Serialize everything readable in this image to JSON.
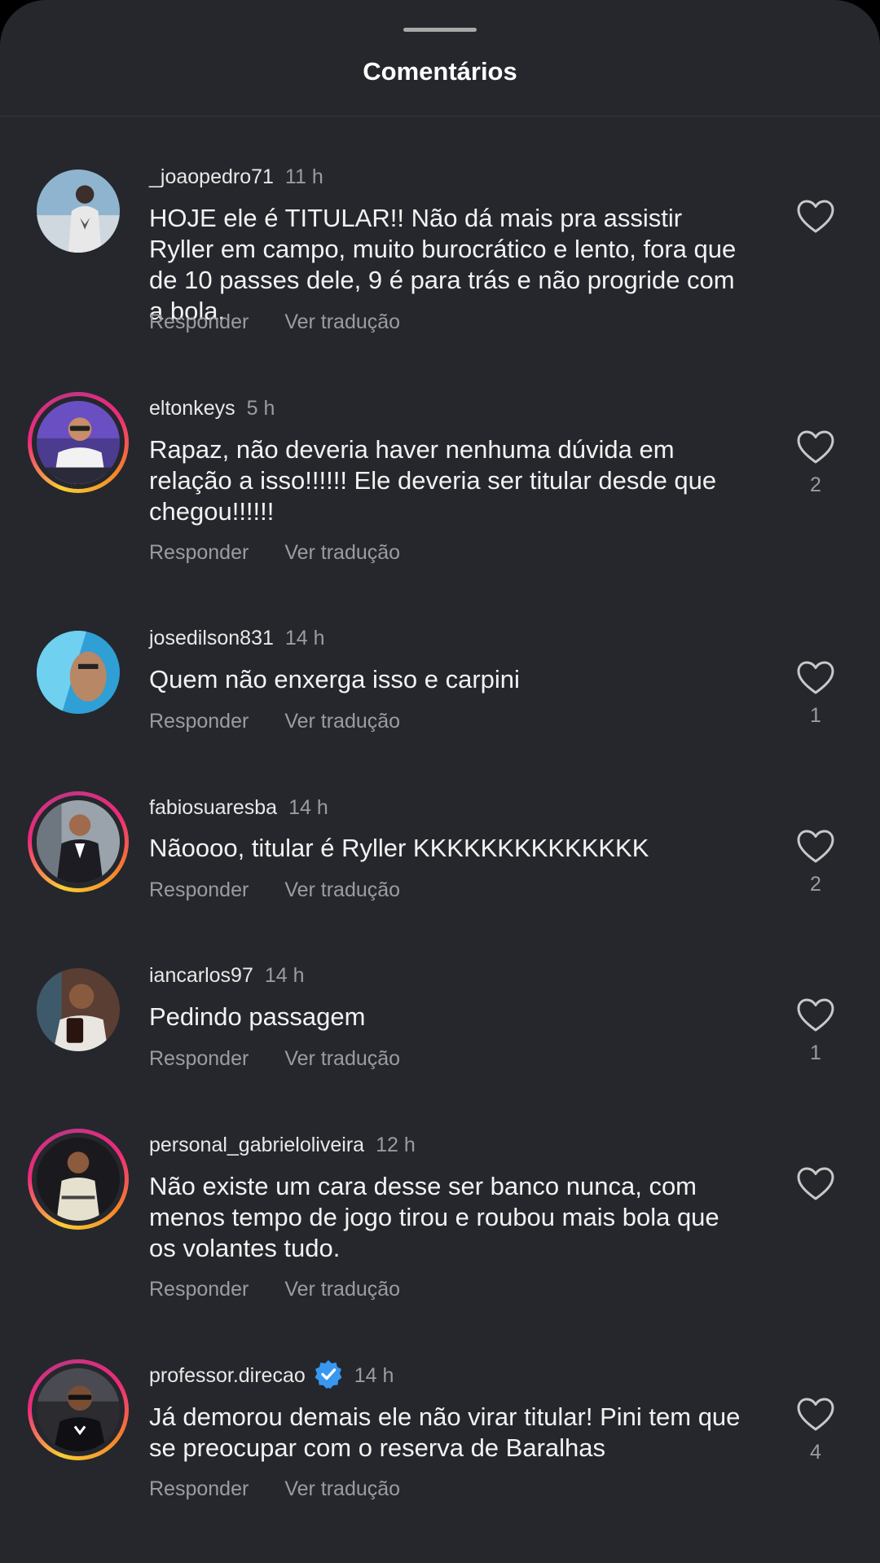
{
  "header": {
    "title": "Comentários"
  },
  "comments": [
    {
      "username": "_joaopedro71",
      "time": "11 h",
      "text": "HOJE ele é TITULAR!! Não dá mais pra assistir Ryller em campo, muito burocrático e lento, fora que de 10 passes dele, 9 é para trás e não progride com a bola.",
      "reply_label": "Responder",
      "translate_label": "Ver tradução",
      "likes": "",
      "story_ring": false,
      "verified": false
    },
    {
      "username": "eltonkeys",
      "time": "5 h",
      "text": "Rapaz, não deveria haver nenhuma dúvida em relação a isso!!!!!! Ele deveria ser titular desde que chegou!!!!!!",
      "reply_label": "Responder",
      "translate_label": "Ver tradução",
      "likes": "2",
      "story_ring": true,
      "verified": false
    },
    {
      "username": "josedilson831",
      "time": "14 h",
      "text": "Quem não enxerga isso e carpini",
      "reply_label": "Responder",
      "translate_label": "Ver tradução",
      "likes": "1",
      "story_ring": false,
      "verified": false
    },
    {
      "username": "fabiosuaresba",
      "time": "14 h",
      "text": "Nãoooo, titular é Ryller KKKKKKKKKKKKKK",
      "reply_label": "Responder",
      "translate_label": "Ver tradução",
      "likes": "2",
      "story_ring": true,
      "verified": false
    },
    {
      "username": "iancarlos97",
      "time": "14 h",
      "text": "Pedindo passagem",
      "reply_label": "Responder",
      "translate_label": "Ver tradução",
      "likes": "1",
      "story_ring": false,
      "verified": false
    },
    {
      "username": "personal_gabrieloliveira",
      "time": "12 h",
      "text": "Não existe um cara desse ser banco nunca, com menos tempo de jogo tirou e roubou mais bola que os volantes tudo.",
      "reply_label": "Responder",
      "translate_label": "Ver tradução",
      "likes": "",
      "story_ring": true,
      "verified": false
    },
    {
      "username": "professor.direcao",
      "time": "14 h",
      "text": "Já demorou demais ele não virar titular! Pini tem que se preocupar com o reserva de Baralhas",
      "reply_label": "Responder",
      "translate_label": "Ver tradução",
      "likes": "4",
      "story_ring": true,
      "verified": true
    }
  ],
  "icons": {
    "like": "heart-outline-icon",
    "verified": "verified-badge-icon"
  },
  "colors": {
    "background": "#25272c",
    "text_primary": "#f2f2f2",
    "text_secondary": "#9a9ca1",
    "verified_blue": "#3897f0"
  }
}
